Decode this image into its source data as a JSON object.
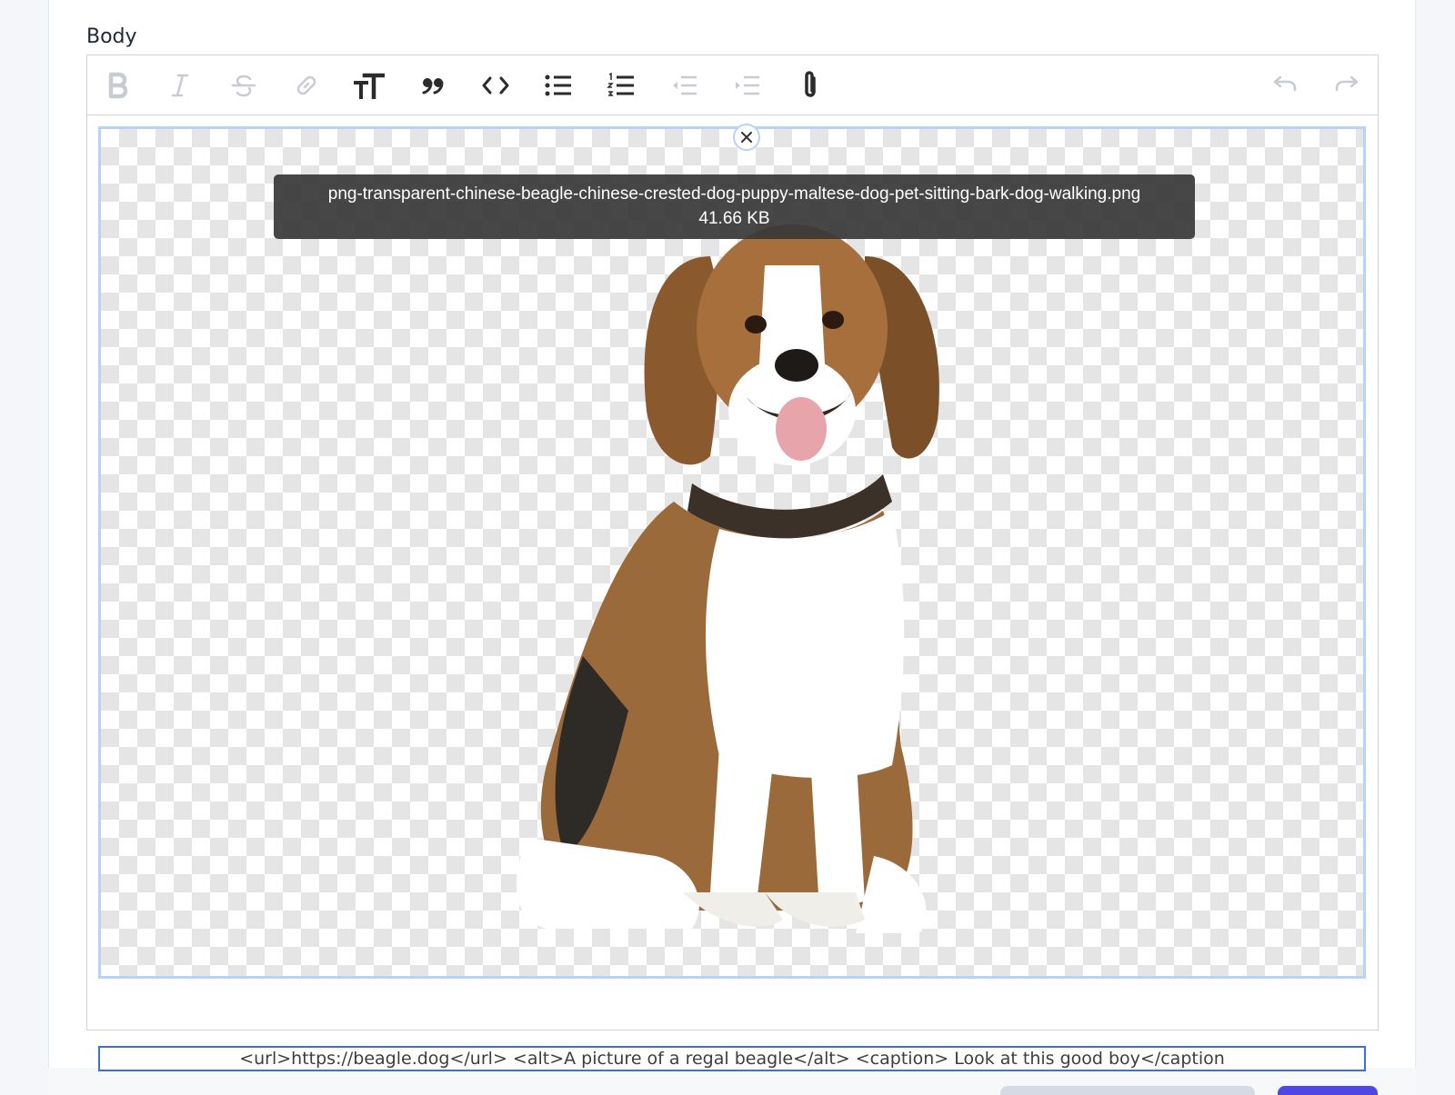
{
  "field": {
    "label": "Body"
  },
  "toolbar": {
    "buttons": [
      {
        "name": "bold-icon",
        "state": "disabled"
      },
      {
        "name": "italic-icon",
        "state": "disabled"
      },
      {
        "name": "strikethrough-icon",
        "state": "disabled"
      },
      {
        "name": "link-icon",
        "state": "disabled"
      },
      {
        "name": "heading-icon",
        "state": "active"
      },
      {
        "name": "quote-icon",
        "state": "active"
      },
      {
        "name": "code-icon",
        "state": "active"
      },
      {
        "name": "bullet-list-icon",
        "state": "active"
      },
      {
        "name": "numbered-list-icon",
        "state": "active"
      },
      {
        "name": "decrease-indent-icon",
        "state": "disabled"
      },
      {
        "name": "increase-indent-icon",
        "state": "disabled"
      },
      {
        "name": "attach-file-icon",
        "state": "active"
      },
      {
        "name": "undo-icon",
        "state": "disabled"
      },
      {
        "name": "redo-icon",
        "state": "disabled"
      }
    ]
  },
  "attachment": {
    "filename": "png-transparent-chinese-beagle-chinese-crested-dog-puppy-maltese-dog-pet-sitting-bark-dog-walking.png",
    "filesize": "41.66 KB",
    "remove_icon": "close-icon",
    "caption": "<url>https://beagle.dog</url> <alt>A picture of a regal beagle</alt> <caption> Look at this good boy</caption"
  },
  "colors": {
    "active_icon": "#2b2b2b",
    "disabled_icon": "#c8ccd2",
    "selection_border": "#b9d3f7",
    "caption_border": "#3b6fd9",
    "primary_button": "#4f46e5"
  }
}
